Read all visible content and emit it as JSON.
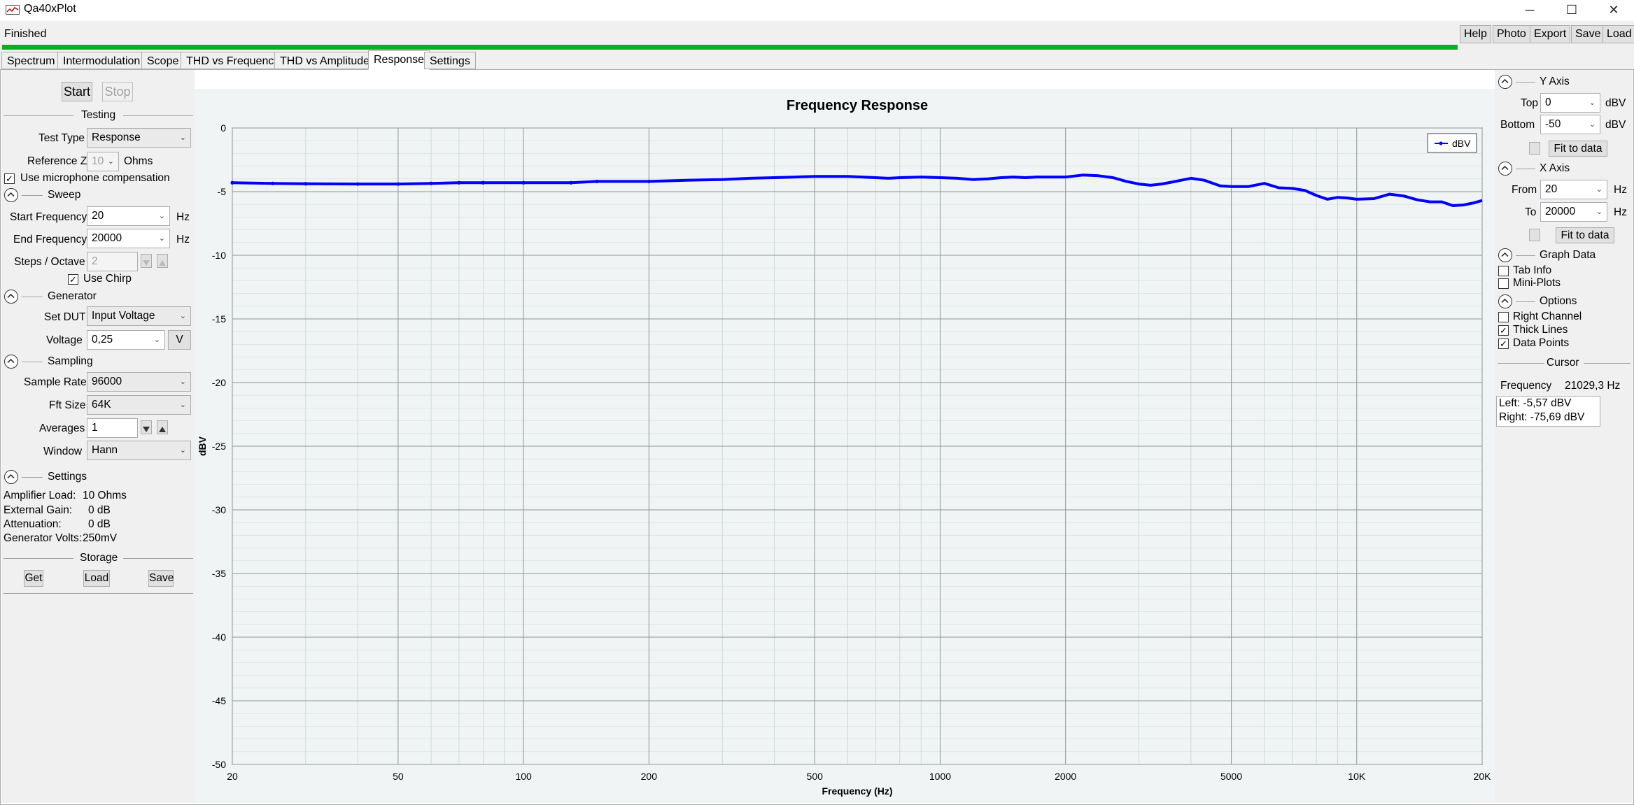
{
  "window": {
    "title": "Qa40xPlot",
    "minimize": "─",
    "maximize": "☐",
    "close": "✕"
  },
  "status": {
    "text": "Finished",
    "progress_percent": 100
  },
  "topbar": {
    "help": "Help",
    "photo": "Photo",
    "export": "Export",
    "save": "Save",
    "load": "Load"
  },
  "tabs": [
    "Spectrum",
    "Intermodulation",
    "Scope",
    "THD vs Frequency",
    "THD vs Amplitude",
    "Response",
    "Settings"
  ],
  "active_tab": "Response",
  "left": {
    "start": "Start",
    "stop": "Stop",
    "testing_header": "Testing",
    "test_type_label": "Test Type",
    "test_type_value": "Response",
    "reference_z_label": "Reference Z",
    "reference_z_value": "10",
    "reference_z_unit": "Ohms",
    "mic_comp_label": "Use microphone compensation",
    "mic_comp_checked": true,
    "sweep_header": "Sweep",
    "start_freq_label": "Start Frequency",
    "start_freq_value": "20",
    "end_freq_label": "End Frequency",
    "end_freq_value": "20000",
    "hz": "Hz",
    "steps_label": "Steps / Octave",
    "steps_value": "2",
    "use_chirp_label": "Use Chirp",
    "use_chirp_checked": true,
    "generator_header": "Generator",
    "set_dut_label": "Set DUT",
    "set_dut_value": "Input Voltage",
    "voltage_label": "Voltage",
    "voltage_value": "0,25",
    "voltage_unit": "V",
    "sampling_header": "Sampling",
    "sample_rate_label": "Sample Rate",
    "sample_rate_value": "96000",
    "fft_size_label": "Fft Size",
    "fft_size_value": "64K",
    "averages_label": "Averages",
    "averages_value": "1",
    "window_label": "Window",
    "window_value": "Hann",
    "settings_header": "Settings",
    "amp_load_label": "Amplifier Load:",
    "amp_load_value": "10 Ohms",
    "ext_gain_label": "External Gain:",
    "ext_gain_value": "0 dB",
    "attenuation_label": "Attenuation:",
    "attenuation_value": "0 dB",
    "gen_volts_label": "Generator Volts:",
    "gen_volts_value": "250mV",
    "storage_header": "Storage",
    "get": "Get",
    "load": "Load",
    "save": "Save"
  },
  "right": {
    "y_axis_header": "Y Axis",
    "top_label": "Top",
    "top_value": "0",
    "bottom_label": "Bottom",
    "bottom_value": "-50",
    "dbv": "dBV",
    "fit_to_data": "Fit to data",
    "x_axis_header": "X Axis",
    "from_label": "From",
    "from_value": "20",
    "to_label": "To",
    "to_value": "20000",
    "hz": "Hz",
    "graph_data_header": "Graph Data",
    "tab_info_label": "Tab Info",
    "tab_info_checked": false,
    "mini_plots_label": "Mini-Plots",
    "mini_plots_checked": false,
    "options_header": "Options",
    "right_channel_label": "Right Channel",
    "right_channel_checked": false,
    "thick_lines_label": "Thick Lines",
    "thick_lines_checked": true,
    "data_points_label": "Data Points",
    "data_points_checked": true,
    "cursor_header": "Cursor",
    "frequency_label": "Frequency",
    "frequency_value": "21029,3 Hz",
    "left_readout": "Left: -5,57 dBV",
    "right_readout": "Right: -75,69 dBV"
  },
  "chart_data": {
    "type": "line",
    "title": "Frequency Response",
    "xlabel": "Frequency (Hz)",
    "ylabel": "dBV",
    "x_scale": "log",
    "xlim": [
      20,
      20000
    ],
    "ylim": [
      -50,
      0
    ],
    "x_ticks": [
      20,
      50,
      100,
      200,
      500,
      1000,
      2000,
      5000,
      10000,
      20000
    ],
    "x_tick_labels": [
      "20",
      "50",
      "100",
      "200",
      "500",
      "1000",
      "2000",
      "5000",
      "10K",
      "20K"
    ],
    "y_ticks": [
      0,
      -5,
      -10,
      -15,
      -20,
      -25,
      -30,
      -35,
      -40,
      -45,
      -50
    ],
    "y_tick_labels": [
      "0",
      "-5",
      "-10",
      "-15",
      "-20",
      "-25",
      "-30",
      "-35",
      "-40",
      "-45",
      "-50"
    ],
    "grid": true,
    "legend_position": "top-right",
    "series": [
      {
        "name": "dBV",
        "color": "#0000ff",
        "x": [
          20,
          25,
          30,
          40,
          50,
          60,
          70,
          80,
          100,
          130,
          150,
          200,
          250,
          300,
          350,
          400,
          450,
          500,
          600,
          700,
          750,
          800,
          900,
          1000,
          1100,
          1200,
          1300,
          1400,
          1500,
          1600,
          1700,
          1800,
          2000,
          2200,
          2400,
          2600,
          2800,
          3000,
          3200,
          3400,
          3600,
          3800,
          4000,
          4300,
          4700,
          5000,
          5500,
          6000,
          6500,
          7000,
          7500,
          8000,
          8500,
          9000,
          9500,
          10000,
          11000,
          12000,
          13000,
          14000,
          15000,
          16000,
          17000,
          18000,
          19000,
          20000
        ],
        "y": [
          -4.3,
          -4.35,
          -4.38,
          -4.4,
          -4.4,
          -4.35,
          -4.3,
          -4.3,
          -4.3,
          -4.3,
          -4.2,
          -4.2,
          -4.1,
          -4.05,
          -3.95,
          -3.9,
          -3.85,
          -3.8,
          -3.8,
          -3.9,
          -3.95,
          -3.9,
          -3.85,
          -3.9,
          -3.95,
          -4.05,
          -4.0,
          -3.9,
          -3.85,
          -3.9,
          -3.85,
          -3.85,
          -3.85,
          -3.7,
          -3.75,
          -3.9,
          -4.2,
          -4.4,
          -4.5,
          -4.4,
          -4.25,
          -4.1,
          -3.95,
          -4.1,
          -4.55,
          -4.6,
          -4.6,
          -4.35,
          -4.7,
          -4.75,
          -4.9,
          -5.3,
          -5.6,
          -5.45,
          -5.5,
          -5.6,
          -5.55,
          -5.2,
          -5.35,
          -5.65,
          -5.8,
          -5.8,
          -6.1,
          -6.05,
          -5.9,
          -5.7
        ]
      }
    ]
  }
}
